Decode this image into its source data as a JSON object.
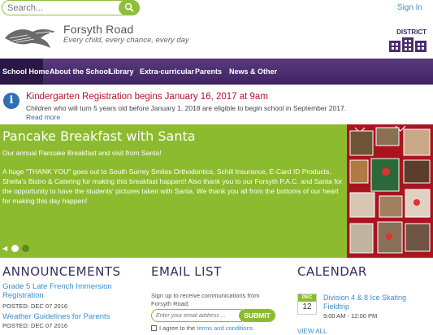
{
  "topbar": {
    "search_placeholder": "Search...",
    "signin_label": "Sign In"
  },
  "header": {
    "school_name": "Forsyth Road",
    "tagline": "Every child, every chance, every day",
    "district_label": "DISTRICT"
  },
  "nav": {
    "items": [
      {
        "label": "School Home"
      },
      {
        "label": "About the School"
      },
      {
        "label": "Library"
      },
      {
        "label": "Extra-curricular"
      },
      {
        "label": "Parents"
      },
      {
        "label": "News & Other"
      }
    ]
  },
  "alert": {
    "title": "Kindergarten Registration begins January 16, 2017 at 9am",
    "body": "Children who will turn 5 years old before January 1, 2018 are eligible to begin school in September 2017.",
    "link": "Read more"
  },
  "hero": {
    "title": "Pancake Breakfast with Santa",
    "subtitle": "Our annual Pancake Breakfast and visit from Santa!",
    "body": "A huge \"THANK YOU\" goes out to South Surrey Smiles Orthodontics, Schill Insurance, E-Card ID Products, Sheila's Bistro & Catering for making this breakfast happen!! Also thank you to our Forsyth P.A.C. and Santa for the opportunity to have the students' pictures taken with Santa.  We thank you all from the bottoms of our heart for making this day happen!",
    "active_slide": 1,
    "slide_count": 2
  },
  "announcements": {
    "title": "ANNOUNCEMENTS",
    "items": [
      {
        "title": "Grade 5 Late French Immersion Registration",
        "date": "POSTED: DEC 07 2016"
      },
      {
        "title": "Weather Guidelines for Parents",
        "date": "POSTED: DEC 07 2016"
      }
    ]
  },
  "email": {
    "title": "EMAIL LIST",
    "description": "Sign up to receive communications from Forsyth Road:",
    "placeholder": "Enter your email address ...",
    "submit_label": "SUBMIT",
    "agree_prefix": "I agree to the",
    "agree_link": "terms and conditions"
  },
  "calendar": {
    "title": "CALENDAR",
    "event": {
      "month": "DEC",
      "day": "12",
      "title": "Division 4 & 8 Ice Skating Fieldtrip",
      "time": "9:00 AM - 12:00 PM"
    },
    "view_all": "VIEW ALL"
  },
  "colors": {
    "brand_purple": "#4a2d6e",
    "accent_green": "#8dbb2f",
    "alert_red": "#b0152e",
    "link_blue": "#3a8ec9"
  }
}
